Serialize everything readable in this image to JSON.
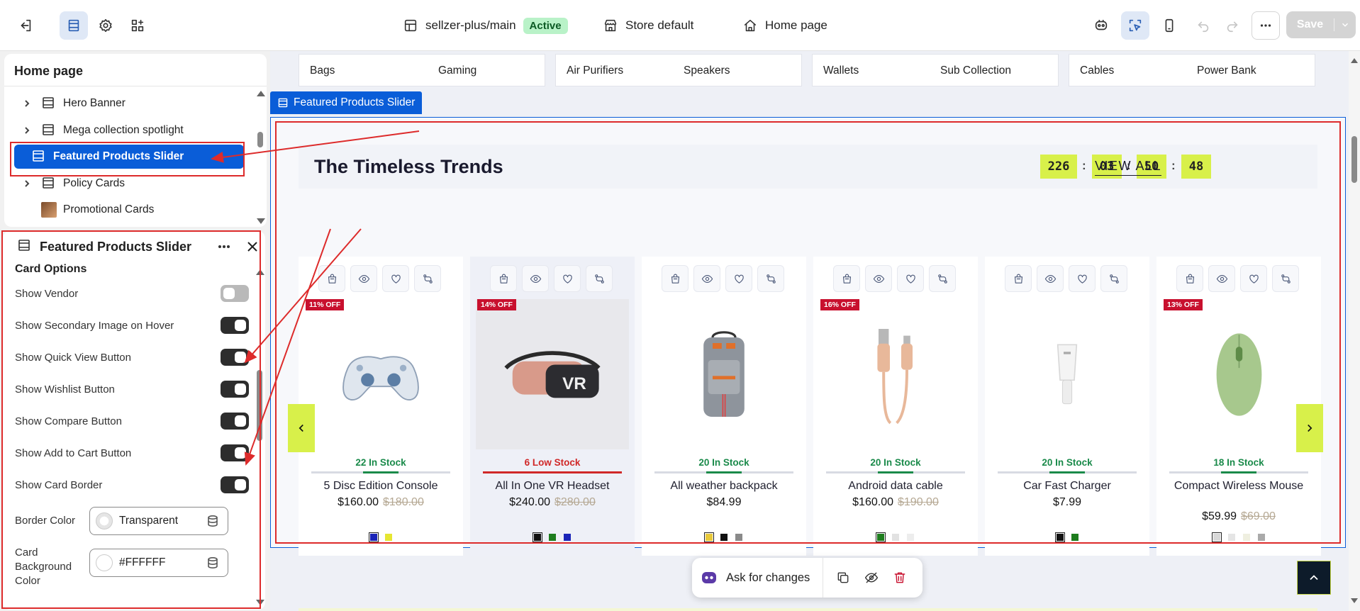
{
  "topbar": {
    "repo": "sellzer-plus/main",
    "status": "Active",
    "store": "Store default",
    "page": "Home page",
    "save_label": "Save"
  },
  "tree_panel": {
    "title": "Home page",
    "items": [
      {
        "label": "Hero Banner",
        "icon": "section-icon"
      },
      {
        "label": "Mega collection spotlight",
        "icon": "section-icon"
      },
      {
        "label": "Featured Products Slider",
        "icon": "section-icon",
        "selected": true
      },
      {
        "label": "Policy Cards",
        "icon": "section-icon"
      },
      {
        "label": "Promotional Cards",
        "icon": "image-thumbnail"
      }
    ]
  },
  "settings_panel": {
    "title": "Featured Products Slider",
    "group_title": "Card Options",
    "toggles": [
      {
        "label": "Show Vendor",
        "on": false
      },
      {
        "label": "Show Secondary Image on Hover",
        "on": true
      },
      {
        "label": "Show Quick View Button",
        "on": true
      },
      {
        "label": "Show Wishlist Button",
        "on": true
      },
      {
        "label": "Show Compare Button",
        "on": true
      },
      {
        "label": "Show Add to Cart Button",
        "on": true
      },
      {
        "label": "Show Card Border",
        "on": true
      }
    ],
    "border_color": {
      "label": "Border Color",
      "value": "Transparent"
    },
    "bg_color": {
      "label": "Card Background Color",
      "value": "#FFFFFF"
    }
  },
  "categories": [
    [
      "Bags",
      "Gaming"
    ],
    [
      "Air Purifiers",
      "Speakers"
    ],
    [
      "Wallets",
      "Sub Collection"
    ],
    [
      "Cables",
      "Power Bank"
    ]
  ],
  "section": {
    "tab_label": "Featured Products Slider",
    "title": "The Timeless Trends",
    "countdown": [
      "226",
      "03",
      "50",
      "48"
    ],
    "separator": ":",
    "view_all": "VIEW ALL",
    "accent": "#d8f04a"
  },
  "products": [
    {
      "discount": "11% OFF",
      "stock": "22 In Stock",
      "stock_color": "#1a8a4a",
      "name": "5 Disc Edition Console",
      "price": "$160.00",
      "compare": "$180.00",
      "swatches": [
        "#1a24b8",
        "#e6e632"
      ],
      "image": "game-controller"
    },
    {
      "discount": "14% OFF",
      "stock": "6 Low Stock",
      "stock_color": "#d02828",
      "name": "All In One VR Headset",
      "price": "$240.00",
      "compare": "$280.00",
      "swatches": [
        "#111111",
        "#1e7d1e",
        "#1a24b8"
      ],
      "image": "vr-headset"
    },
    {
      "discount": "",
      "stock": "20 In Stock",
      "stock_color": "#1a8a4a",
      "name": "All weather backpack",
      "price": "$84.99",
      "compare": "",
      "swatches": [
        "#e8c93a",
        "#111111",
        "#8a8a8a"
      ],
      "image": "backpack"
    },
    {
      "discount": "16% OFF",
      "stock": "20 In Stock",
      "stock_color": "#1a8a4a",
      "name": "Android data cable",
      "price": "$160.00",
      "compare": "$190.00",
      "swatches": [
        "#1e7d1e",
        "#e2e2e2",
        "#ededed"
      ],
      "image": "usb-cable"
    },
    {
      "discount": "",
      "stock": "20 In Stock",
      "stock_color": "#1a8a4a",
      "name": "Car Fast Charger",
      "price": "$7.99",
      "compare": "",
      "swatches": [
        "#111111",
        "#1e7d1e"
      ],
      "image": "car-charger"
    },
    {
      "discount": "13% OFF",
      "stock": "18 In Stock",
      "stock_color": "#1a8a4a",
      "name": "Compact Wireless Mouse",
      "price": "$59.99",
      "compare": "$69.00",
      "swatches": [
        "#d8d8d8",
        "#e5e5e5",
        "#efefe0",
        "#aaaaaa"
      ],
      "image": "wireless-mouse"
    }
  ],
  "float_bar": {
    "ask_label": "Ask for changes"
  }
}
